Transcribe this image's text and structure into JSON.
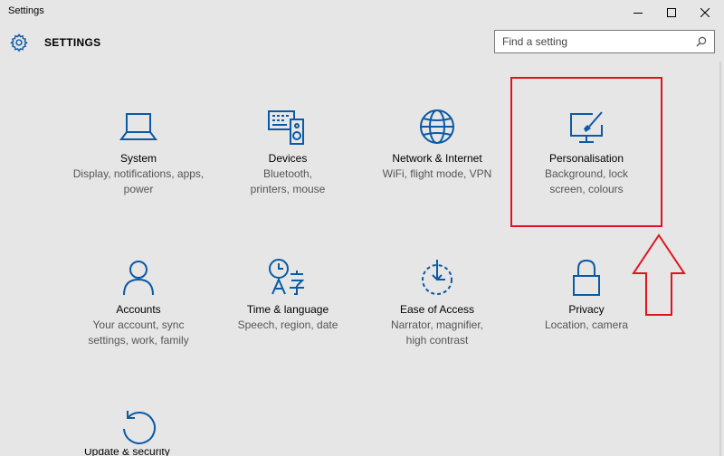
{
  "window": {
    "title": "Settings",
    "controls": {
      "minimize": "minimize-icon",
      "maximize": "maximize-icon",
      "close": "close-icon"
    }
  },
  "header": {
    "icon": "gear-icon",
    "title": "SETTINGS",
    "search": {
      "placeholder": "Find a setting",
      "value": "",
      "icon": "search-icon"
    }
  },
  "colors": {
    "accent": "#0b5aa6",
    "background": "#e6e6e6",
    "annotation": "#e0141e"
  },
  "categories": [
    {
      "name": "System",
      "description": "Display, notifications, apps, power",
      "icon": "laptop-icon"
    },
    {
      "name": "Devices",
      "description": "Bluetooth, printers, mouse",
      "icon": "devices-icon"
    },
    {
      "name": "Network & Internet",
      "description": "WiFi, flight mode, VPN",
      "icon": "globe-icon"
    },
    {
      "name": "Personalisation",
      "description": "Background, lock screen, colours",
      "icon": "personalisation-icon"
    },
    {
      "name": "Accounts",
      "description": "Your account, sync settings, work, family",
      "icon": "person-icon"
    },
    {
      "name": "Time & language",
      "description": "Speech, region, date",
      "icon": "time-language-icon"
    },
    {
      "name": "Ease of Access",
      "description": "Narrator, magnifier, high contrast",
      "icon": "ease-of-access-icon"
    },
    {
      "name": "Privacy",
      "description": "Location, camera",
      "icon": "lock-icon"
    },
    {
      "name": "Update & security",
      "description": "",
      "icon": "update-icon"
    }
  ],
  "annotation": {
    "highlighted_category": "Personalisation",
    "shapes": [
      "rectangle",
      "up-arrow"
    ]
  }
}
